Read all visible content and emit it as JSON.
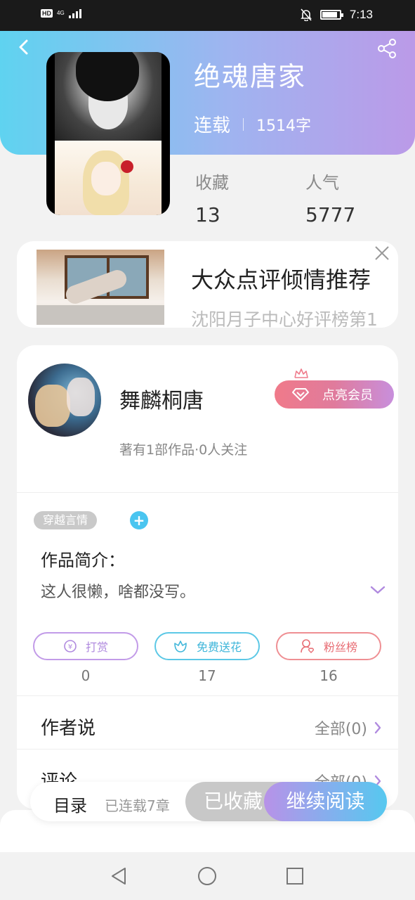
{
  "status_bar": {
    "hd": "HD",
    "network": "4G",
    "time": "7:13"
  },
  "header": {
    "icons": {
      "back": "back-arrow-icon",
      "share": "share-icon"
    },
    "gradient": [
      "#5fd3f0",
      "#9fb4f0",
      "#bb9ae8"
    ]
  },
  "book": {
    "title": "绝魂唐家",
    "status": "连载",
    "words": "1514字",
    "favorites_label": "收藏",
    "favorites": "13",
    "popularity_label": "人气",
    "popularity": "5777"
  },
  "ad": {
    "title": "大众点评倾情推荐",
    "subtitle": "沈阳月子中心好评榜第1",
    "close_icon": "close-icon"
  },
  "author": {
    "name": "舞麟桐唐",
    "info": "著有1部作品·0人关注",
    "vip_label": "点亮会员",
    "vip_icons": [
      "crown-icon",
      "diamond-icon"
    ]
  },
  "work": {
    "tag": "穿越言情",
    "add_tag": "+",
    "intro_label": "作品简介：",
    "intro_text": "这人很懒，啥都没写。"
  },
  "actions": [
    {
      "label": "打赏",
      "count": "0",
      "icon": "coin-icon",
      "color": "#b08adf"
    },
    {
      "label": "免费送花",
      "count": "17",
      "icon": "flower-icon",
      "color": "#3fb6da"
    },
    {
      "label": "粉丝榜",
      "count": "16",
      "icon": "fans-icon",
      "color": "#e86d74"
    }
  ],
  "sections": {
    "author_says": {
      "title": "作者说",
      "more": "全部(0)"
    },
    "comments": {
      "title": "评论",
      "more": "全部(0)"
    }
  },
  "bottom_bar": {
    "toc": "目录",
    "toc_status": "已连载7章",
    "collected": "已收藏",
    "read": "继续阅读"
  },
  "nav": {
    "icons": [
      "nav-back-icon",
      "nav-home-icon",
      "nav-recent-icon"
    ]
  }
}
